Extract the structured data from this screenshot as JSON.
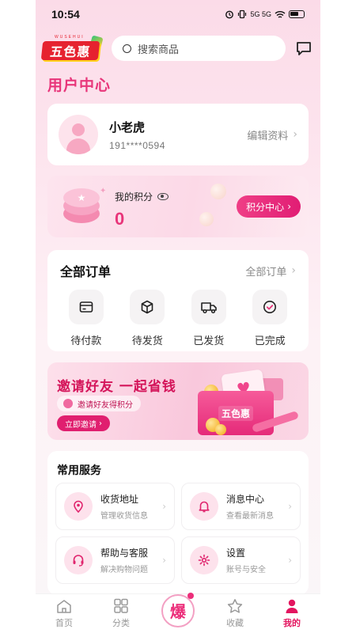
{
  "status_bar": {
    "time": "10:54",
    "network": "5G 5G"
  },
  "header": {
    "logo_text": "五色惠",
    "logo_tagline": "WUSEHUI",
    "search_placeholder": "搜索商品"
  },
  "page_title": "用户中心",
  "user": {
    "name": "小老虎",
    "phone": "191****0594",
    "edit_label": "编辑资料"
  },
  "points": {
    "label": "我的积分",
    "value": "0",
    "button_label": "积分中心"
  },
  "orders": {
    "title": "全部订单",
    "all_label": "全部订单",
    "items": [
      {
        "label": "待付款",
        "icon": "card-icon"
      },
      {
        "label": "待发货",
        "icon": "box-icon"
      },
      {
        "label": "已发货",
        "icon": "truck-icon"
      },
      {
        "label": "已完成",
        "icon": "check-circle-icon"
      }
    ]
  },
  "banner": {
    "title": "邀请好友 一起省钱",
    "subtitle": "邀请好友得积分",
    "button_label": "立即邀请",
    "bag_label": "五色惠"
  },
  "services": {
    "title": "常用服务",
    "items": [
      {
        "name": "收货地址",
        "desc": "管理收货信息",
        "icon": "location-pin-icon"
      },
      {
        "name": "消息中心",
        "desc": "查看最新消息",
        "icon": "bell-icon"
      },
      {
        "name": "帮助与客服",
        "desc": "解决购物问题",
        "icon": "headset-icon"
      },
      {
        "name": "设置",
        "desc": "账号与安全",
        "icon": "gear-icon"
      }
    ]
  },
  "tabbar": {
    "items": [
      {
        "label": "首页",
        "icon": "home-icon"
      },
      {
        "label": "分类",
        "icon": "grid-icon"
      },
      {
        "label": "爆",
        "icon": "hot-deal-icon"
      },
      {
        "label": "收藏",
        "icon": "star-icon"
      },
      {
        "label": "我的",
        "icon": "user-icon"
      }
    ],
    "active_index": 4
  },
  "colors": {
    "accent": "#e8357a",
    "brand_red": "#e6222f"
  }
}
